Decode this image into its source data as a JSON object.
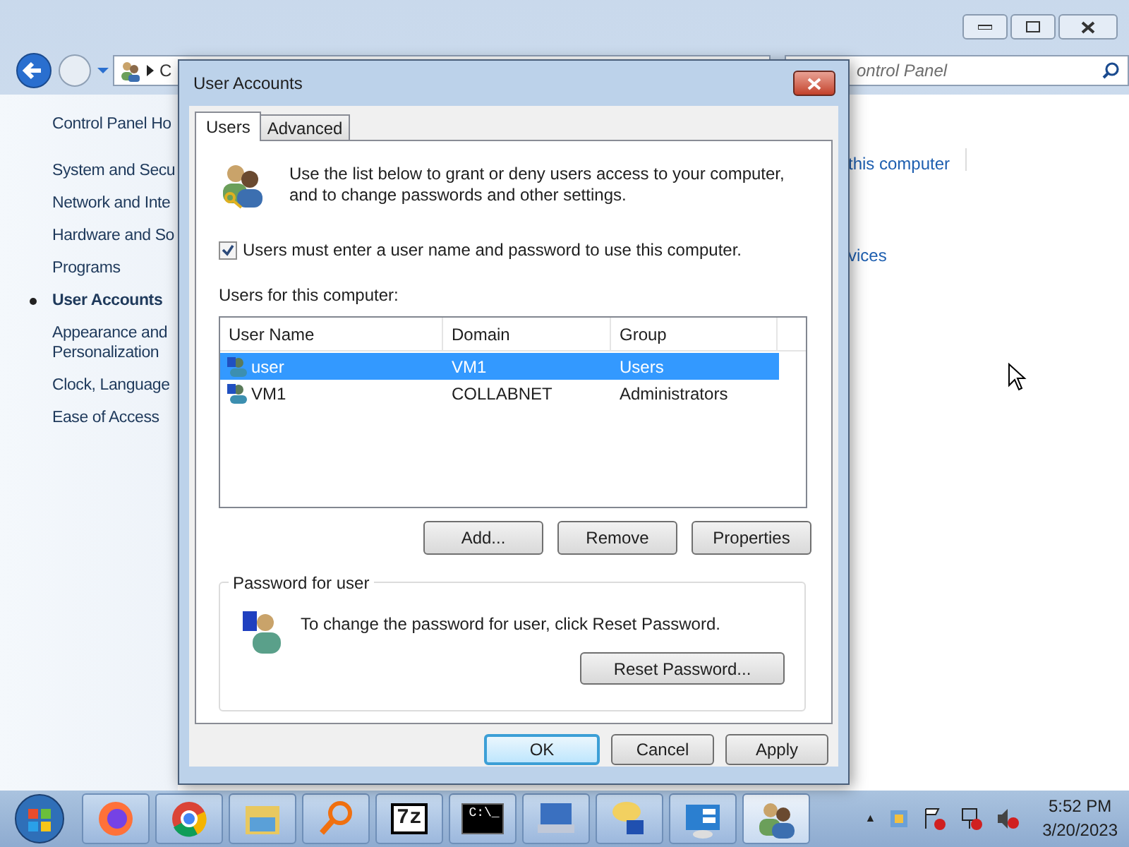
{
  "window": {
    "address": "C",
    "search_placeholder": "ontrol Panel"
  },
  "nav": [
    {
      "label": "Control Panel Ho",
      "selected": false
    },
    {
      "label": "System and Secu",
      "selected": false
    },
    {
      "label": "Network and Inte",
      "selected": false
    },
    {
      "label": "Hardware and So",
      "selected": false
    },
    {
      "label": "Programs",
      "selected": false
    },
    {
      "label": "User Accounts",
      "selected": true
    },
    {
      "label": "Appearance and\nPersonalization",
      "selected": false
    },
    {
      "label": "Clock, Language",
      "selected": false
    },
    {
      "label": "Ease of Access",
      "selected": false
    }
  ],
  "links": [
    "this computer",
    "vices"
  ],
  "dialog": {
    "title": "User Accounts",
    "tabs": [
      {
        "label": "Users",
        "selected": true
      },
      {
        "label": "Advanced",
        "selected": false
      }
    ],
    "intro": [
      "Use the list below to grant or deny users access to your computer,",
      "and to change passwords and other settings."
    ],
    "checkbox": {
      "label": "Users must enter a user name and password to use this computer.",
      "checked": true
    },
    "users_label": "Users for this computer:",
    "columns": [
      "User Name",
      "Domain",
      "Group"
    ],
    "rows": [
      {
        "cells": [
          "user",
          "VM1",
          "Users"
        ],
        "selected": true
      },
      {
        "cells": [
          "VM1",
          "COLLABNET",
          "Administrators"
        ],
        "selected": false
      }
    ],
    "list_buttons": [
      "Add...",
      "Remove",
      "Properties"
    ],
    "password_group": {
      "title": "Password for user",
      "text": "To change the password for user, click Reset Password.",
      "button": "Reset Password..."
    },
    "buttons": [
      {
        "label": "OK",
        "default": true
      },
      {
        "label": "Cancel",
        "default": false
      },
      {
        "label": "Apply",
        "default": false
      }
    ]
  },
  "taskbar": {
    "apps": [
      {
        "kind": "firefox"
      },
      {
        "kind": "chrome"
      },
      {
        "kind": "folder"
      },
      {
        "kind": "magnifier"
      },
      {
        "kind": "archiver",
        "glyph": "7z"
      },
      {
        "kind": "cmd",
        "glyph": "C:\\_"
      },
      {
        "kind": "keyboard"
      },
      {
        "kind": "chat"
      },
      {
        "kind": "panel"
      },
      {
        "kind": "users"
      }
    ],
    "tray_toggle": "▲",
    "time": "5:52 PM",
    "date": "3/20/2023"
  }
}
